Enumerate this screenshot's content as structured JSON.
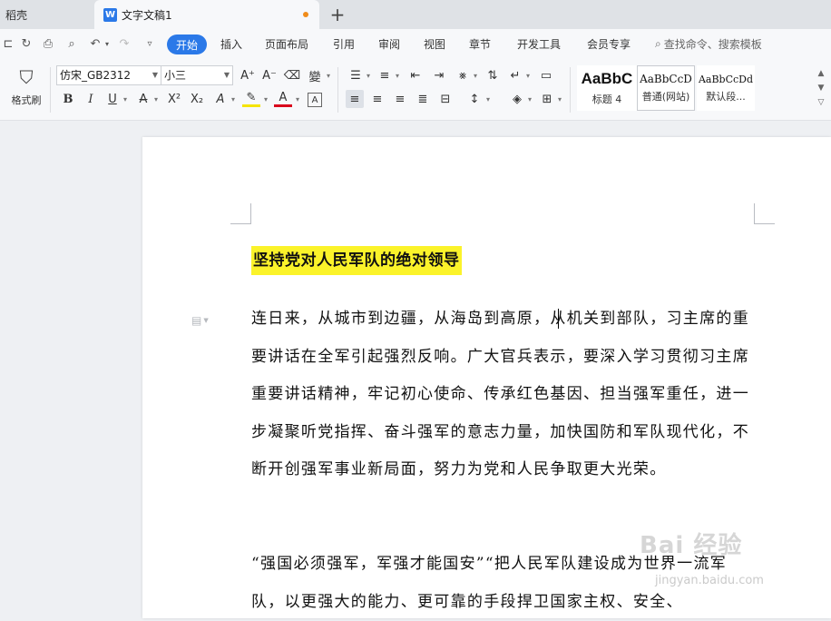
{
  "tabs": {
    "inactive_label": "稻壳",
    "active_label": "文字文稿1",
    "active_icon": "W",
    "unsaved_color": "#f08c1a",
    "new_tab_label": "+"
  },
  "menu": {
    "items": [
      "开始",
      "插入",
      "页面布局",
      "引用",
      "审阅",
      "视图",
      "章节",
      "开发工具",
      "会员专享"
    ],
    "active": "开始",
    "search_placeholder": "查找命令、搜索模板",
    "accent_color": "#2b79e8"
  },
  "ribbon": {
    "format_painter_label": "格式刷",
    "font_name": "仿宋_GB2312",
    "font_size": "小三",
    "styles": [
      {
        "preview": "AaBbC",
        "name": "标题 4"
      },
      {
        "preview": "AaBbCcD",
        "name": "普通(网站)"
      },
      {
        "preview": "AaBbCcDd",
        "name": "默认段..."
      }
    ]
  },
  "document": {
    "title": "坚持党对人民军队的绝对领导",
    "title_highlight": "#fbf32a",
    "paragraph1": "连日来，从城市到边疆，从海岛到高原，从机关到部队，习主席的重要讲话在全军引起强烈反响。广大官兵表示，要深入学习贯彻习主席重要讲话精神，牢记初心使命、传承红色基因、担当强军重任，进一步凝聚听党指挥、奋斗强军的意志力量，加快国防和军队现代化，不断开创强军事业新局面，努力为党和人民争取更大光荣。",
    "paragraph2": "“强国必须强军，军强才能国安”“把人民军队建设成为世界一流军队，以更强大的能力、更可靠的手段捍卫国家主权、安全、"
  },
  "watermark": {
    "text": "Bai 经验",
    "url": "jingyan.baidu.com"
  }
}
